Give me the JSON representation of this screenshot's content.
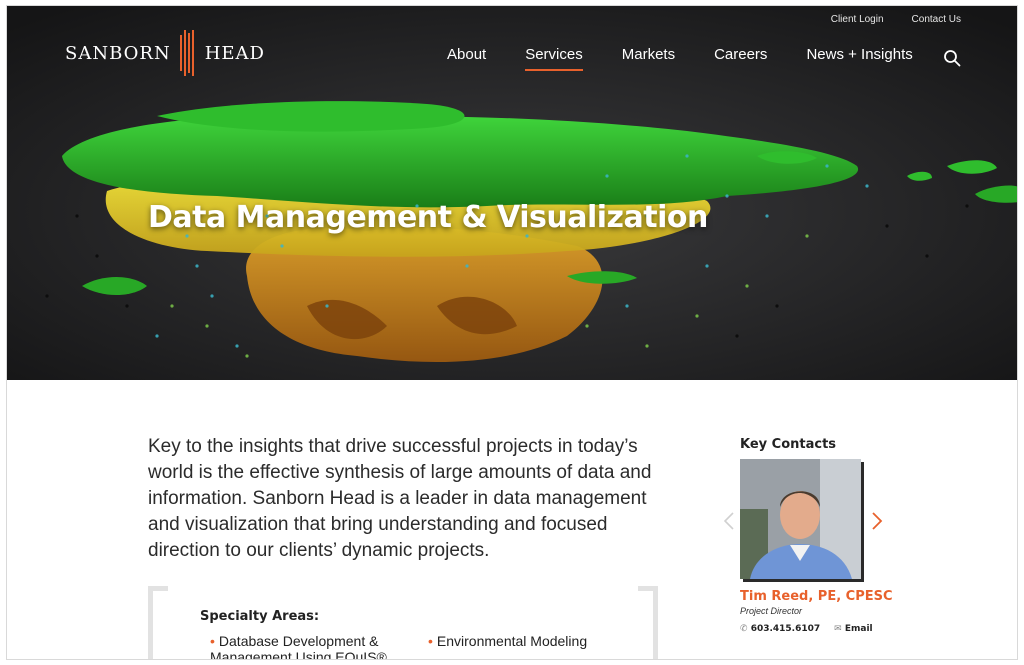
{
  "header": {
    "brand": {
      "left": "SANBORN",
      "right": "HEAD"
    },
    "utility_links": [
      "Client Login",
      "Contact Us"
    ],
    "nav": [
      {
        "label": "About",
        "active": false
      },
      {
        "label": "Services",
        "active": true
      },
      {
        "label": "Markets",
        "active": false
      },
      {
        "label": "Careers",
        "active": false
      },
      {
        "label": "News + Insights",
        "active": false
      }
    ],
    "search_icon": "search-icon",
    "accent": "#e8612c"
  },
  "hero": {
    "title": "Data Management & Visualization"
  },
  "intro": "Key to the insights that drive successful projects in today’s world is the effective synthesis of large amounts of data and information. Sanborn Head is a leader in data management and visualization that bring understanding and focused direction to our clients’ dynamic projects.",
  "specialty": {
    "title": "Specialty Areas:",
    "items": [
      "Database Development & Management Using EQuIS®",
      "Environmental Modeling"
    ]
  },
  "contacts": {
    "title": "Key Contacts",
    "person": {
      "name": "Tim Reed, PE, CPESC",
      "role": "Project Director",
      "phone": "603.415.6107",
      "email_label": "Email"
    }
  }
}
